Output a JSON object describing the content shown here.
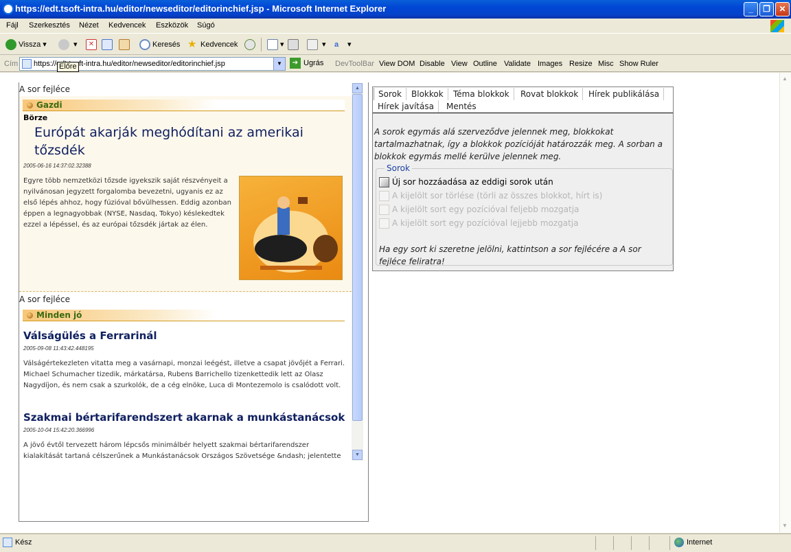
{
  "window": {
    "title": "https://edt.tsoft-intra.hu/editor/newseditor/editorinchief.jsp - Microsoft Internet Explorer"
  },
  "menu": [
    "Fájl",
    "Szerkesztés",
    "Nézet",
    "Kedvencek",
    "Eszközök",
    "Súgó"
  ],
  "toolbar": {
    "back": "Vissza",
    "search": "Keresés",
    "favorites": "Kedvencek"
  },
  "address": {
    "label": "Cím",
    "url": "https://edt.tsoft-intra.hu/editor/newseditor/editorinchief.jsp",
    "go": "Ugrás",
    "tooltip": "Előre"
  },
  "devtools": [
    "DevToolBar",
    "View DOM",
    "Disable",
    "View",
    "Outline",
    "Validate",
    "Images",
    "Resize",
    "Misc",
    "Show Ruler"
  ],
  "rows": [
    {
      "header": "A sor fejléce",
      "category": "Gazdi",
      "subcategory": "Börze",
      "article": {
        "title": "Európát akarják meghódítani az amerikai tőzsdék",
        "date": "2005-06-16 14:37:02.32388",
        "body": "Egyre több nemzetközi tőzsde igyekszik saját részvényeit a nyilvánosan jegyzett forgalomba bevezetni, ugyanis ez az első lépés ahhoz, hogy fúzióval bővülhessen. Eddig azonban éppen a legnagyobbak (NYSE, Nasdaq, Tokyo) késlekedtek ezzel a lépéssel, és az európai tőzsdék jártak az élen."
      }
    },
    {
      "header": "A sor fejléce",
      "category": "Minden jó",
      "articles": [
        {
          "title": "Válságülés a Ferrarinál",
          "date": "2005-09-08 11:43:42.448195",
          "body": "Válságértekezleten vitatta meg a vasárnapi, monzai  leégést, illetve a csapat jövőjét a Ferrari. Michael Schumacher  tizedik, márkatársa, Rubens Barrichello tizenkettedik lett az Olasz  Nagydíjon, és nem csak a szurkolók, de a cég elnöke, Luca di  Montezemolo is csalódott volt."
        },
        {
          "title": "Szakmai bértarifarendszert akarnak a munkástanácsok",
          "date": "2005-10-04 15:42:20.366996",
          "body": "A jövő évtől tervezett három lépcsős minimálbér helyett szakmai bértarifarendszer kialakítását tartaná célszerűnek a Munkástanácsok Országos Szövetsége &ndash; jelentette"
        }
      ]
    }
  ],
  "panel": {
    "tabs": [
      "Sorok",
      "Blokkok",
      "Téma blokkok",
      "Rovat blokkok",
      "Hírek publikálása",
      "Hírek javítása",
      "Mentés"
    ],
    "description": "A sorok egymás alá szerveződve jelennek meg, blokkokat tartalmazhatnak, így a blokkok pozícióját határozzák meg. A sorban a blokkok egymás mellé kerülve jelennek meg.",
    "legend": "Sorok",
    "actions": [
      {
        "label": "Új sor hozzáadása az eddigi sorok után",
        "enabled": true
      },
      {
        "label": "A kijelölt sor törlése (törli az összes blokkot, hírt is)",
        "enabled": false
      },
      {
        "label": "A kijelölt sort egy pozícióval feljebb mozgatja",
        "enabled": false
      },
      {
        "label": "A kijelölt sort egy pozícióval lejjebb mozgatja",
        "enabled": false
      }
    ],
    "hint": "Ha egy sort ki szeretne jelölni, kattintson a sor fejlécére a A sor fejléce feliratra!"
  },
  "status": {
    "left": "Kész",
    "zone": "Internet"
  }
}
